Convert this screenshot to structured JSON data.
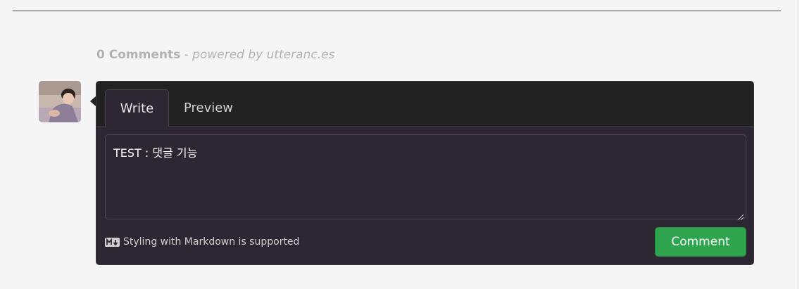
{
  "header": {
    "comment_count": "0 Comments",
    "powered_by": " - powered by utteranc.es"
  },
  "editor": {
    "tabs": [
      {
        "label": "Write",
        "active": true
      },
      {
        "label": "Preview",
        "active": false
      }
    ],
    "textarea_value": "TEST : 댓글 기능",
    "markdown_note": "Styling with Markdown is supported",
    "submit_label": "Comment"
  },
  "icons": {
    "avatar": "user-avatar",
    "markdown": "markdown-icon",
    "resize": "resize-grip-icon"
  },
  "colors": {
    "page_bg": "#f5f5f5",
    "panel_bg": "#2d2733",
    "tab_bar_bg": "#222222",
    "accent_green": "#2ea44f"
  }
}
